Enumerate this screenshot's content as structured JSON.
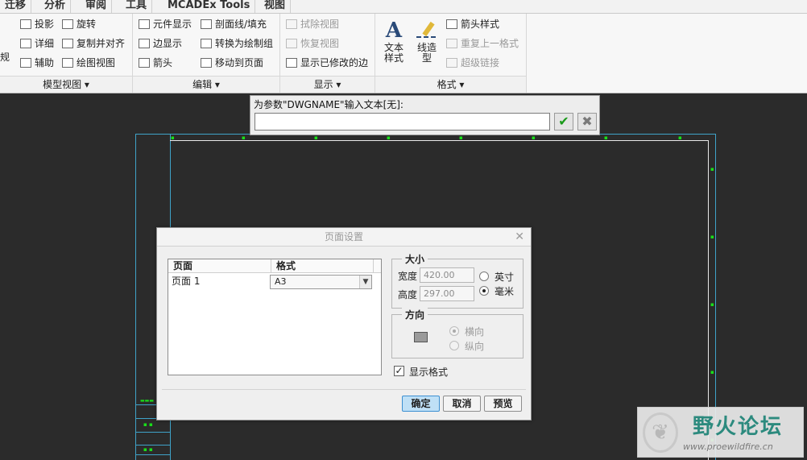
{
  "tabs": [
    "迁移",
    "分析",
    "审阅",
    "工具",
    "MCADEx Tools",
    "视图"
  ],
  "ribbon": {
    "model_views": {
      "title": "模型视图",
      "big_label": "规",
      "items": [
        "投影",
        "旋转",
        "详细",
        "复制并对齐",
        "辅助",
        "绘图视图"
      ]
    },
    "edit": {
      "title": "编辑",
      "items": [
        "元件显示",
        "剖面线/填充",
        "边显示",
        "转换为绘制组",
        "箭头",
        "移动到页面"
      ]
    },
    "display": {
      "title": "显示",
      "items": [
        "拭除视图",
        "恢复视图",
        "显示已修改的边"
      ]
    },
    "format": {
      "title": "格式",
      "text_style": "文本\n样式",
      "line_style": "线造\n型",
      "items": [
        "箭头样式",
        "重复上一格式",
        "超级链接"
      ]
    }
  },
  "prompt": {
    "label": "为参数\"DWGNAME\"输入文本[无]:",
    "value": ""
  },
  "dialog": {
    "title": "页面设置",
    "table": {
      "headers": [
        "页面",
        "格式"
      ],
      "rows": [
        {
          "page": "页面 1",
          "format": "A3"
        }
      ]
    },
    "size": {
      "legend": "大小",
      "width_label": "宽度",
      "width_value": "420.00",
      "height_label": "高度",
      "height_value": "297.00",
      "unit_inch": "英寸",
      "unit_mm": "毫米",
      "selected_unit": "mm"
    },
    "orientation": {
      "legend": "方向",
      "landscape": "横向",
      "portrait": "纵向",
      "selected": "landscape"
    },
    "show_format_label": "显示格式",
    "show_format_checked": true,
    "buttons": {
      "ok": "确定",
      "cancel": "取消",
      "preview": "预览"
    }
  },
  "watermark": {
    "title": "野火论坛",
    "url": "www.proewildfire.cn"
  },
  "colors": {
    "canvas_bg": "#2b2b2b",
    "sheet_border": "#e9e9e9",
    "frame_lines": "#3fa3c9",
    "ok_button": "#bfe0f6"
  }
}
